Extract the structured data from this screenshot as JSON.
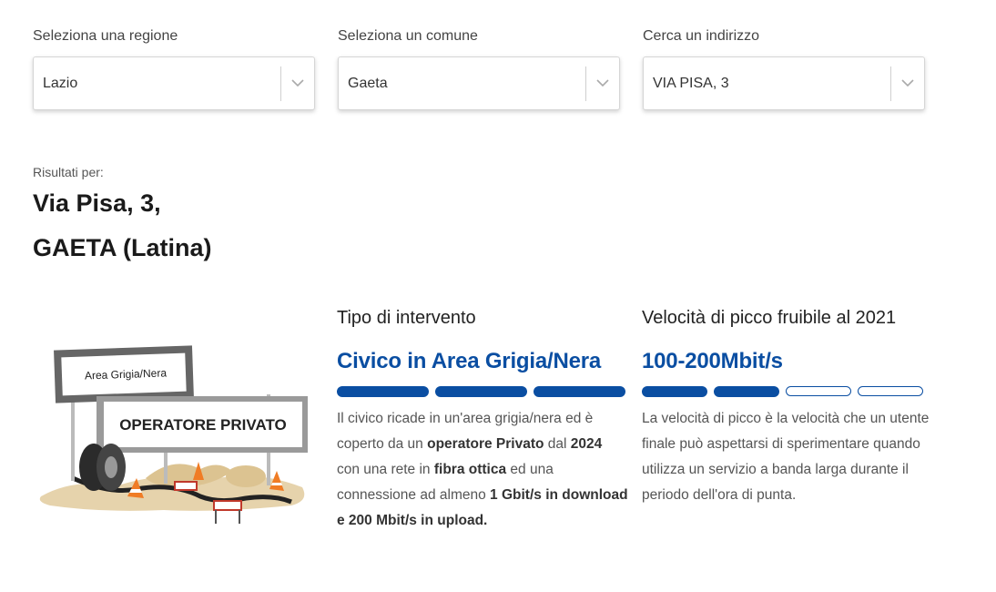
{
  "filters": [
    {
      "label": "Seleziona una regione",
      "value": "Lazio"
    },
    {
      "label": "Seleziona un comune",
      "value": "Gaeta"
    },
    {
      "label": "Cerca un indirizzo",
      "value": "VIA PISA, 3"
    }
  ],
  "results": {
    "label": "Risultati per:",
    "address_line1": "Via Pisa, 3,",
    "address_line2": "GAETA (Latina)"
  },
  "illustration": {
    "sign_top": "Area Grigia/Nera",
    "sign_main": "OPERATORE PRIVATO"
  },
  "intervento": {
    "heading": "Tipo di intervento",
    "value": "Civico in Area Grigia/Nera",
    "bars_filled": 3,
    "bars_total": 3,
    "desc": {
      "p1": "Il civico ricade in un'area grigia/nera ed è coperto da un ",
      "b1": "operatore Privato",
      "p2": " dal ",
      "b2": "2024",
      "p3": " con una rete in ",
      "b3": "fibra ottica",
      "p4": " ed una connessione ad almeno ",
      "b4": "1 Gbit/s in download e 200 Mbit/s in upload."
    }
  },
  "velocita": {
    "heading": "Velocità di picco fruibile al 2021",
    "value": "100-200Mbit/s",
    "bars_filled": 2,
    "bars_total": 5,
    "desc": "La velocità di picco è la velocità che un utente finale può aspettarsi di sperimentare quando utilizza un servizio a banda larga durante il periodo dell'ora di punta."
  },
  "colors": {
    "accent": "#0a4ea2"
  }
}
